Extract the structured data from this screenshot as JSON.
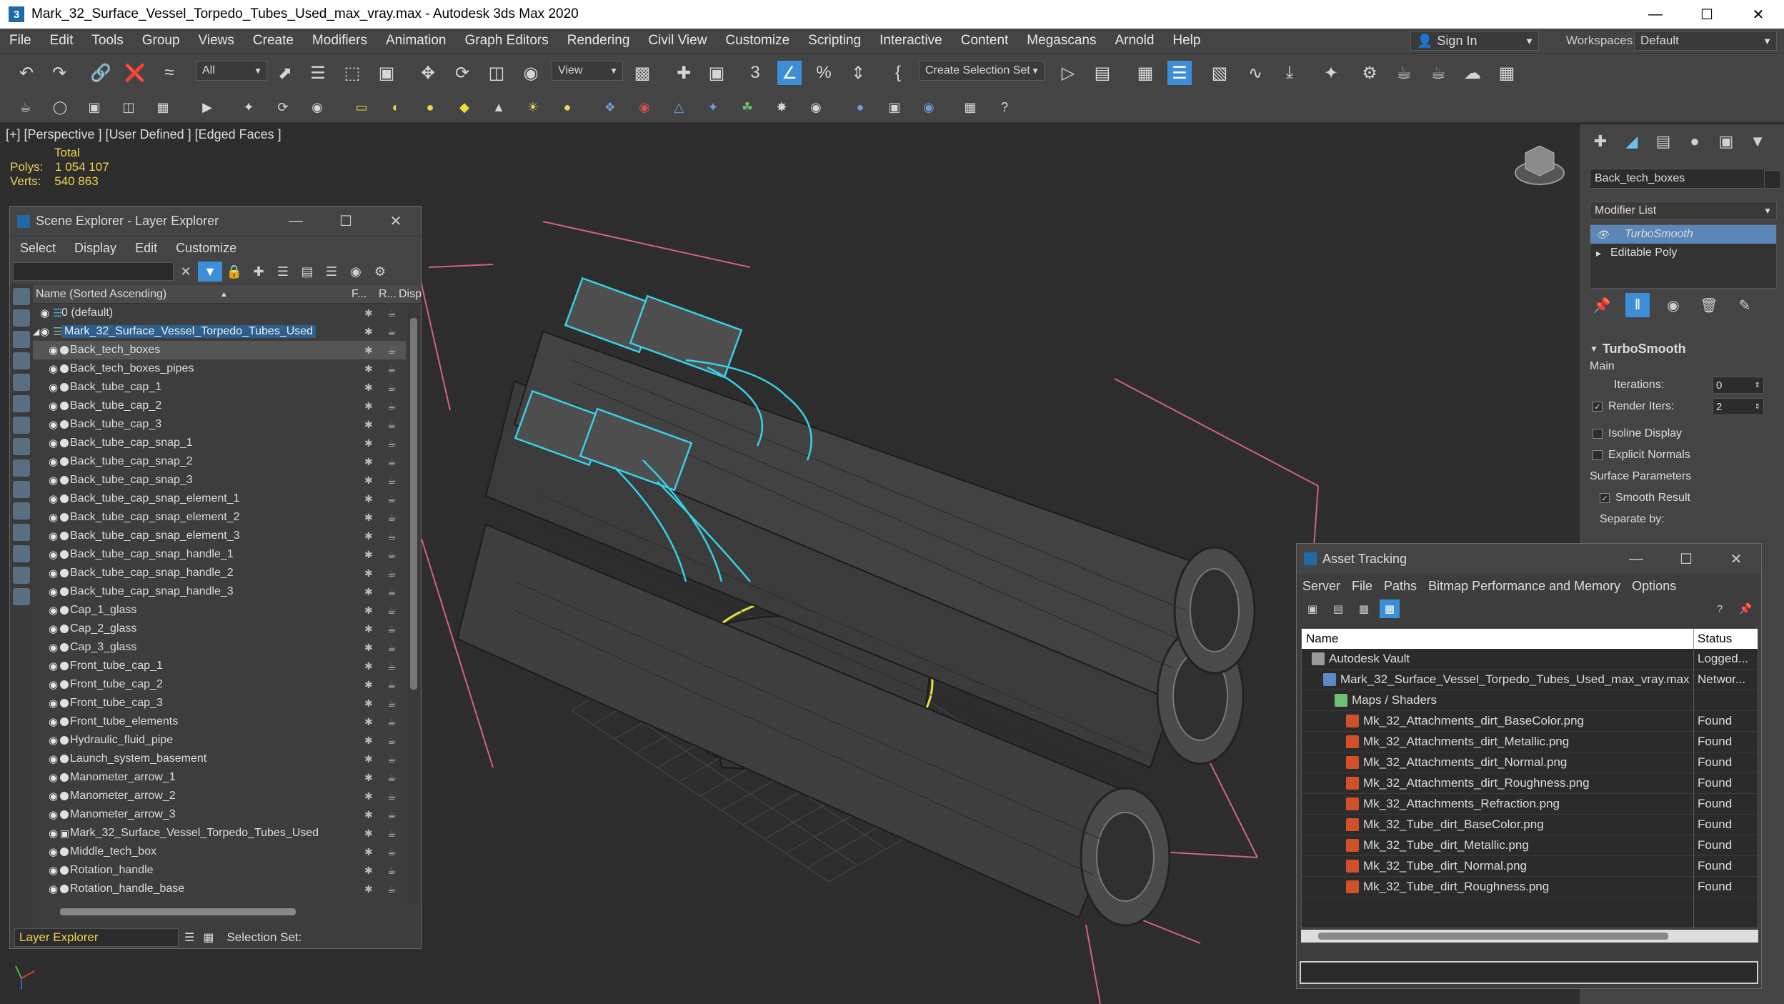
{
  "window": {
    "title": "Mark_32_Surface_Vessel_Torpedo_Tubes_Used_max_vray.max - Autodesk 3ds Max 2020",
    "app_icon": "3"
  },
  "menu": [
    "File",
    "Edit",
    "Tools",
    "Group",
    "Views",
    "Create",
    "Modifiers",
    "Animation",
    "Graph Editors",
    "Rendering",
    "Civil View",
    "Customize",
    "Scripting",
    "Interactive",
    "Content",
    "Megascans",
    "Arnold",
    "Help"
  ],
  "signin": {
    "label": "Sign In"
  },
  "workspaces": {
    "label": "Workspaces:",
    "value": "Default"
  },
  "toolbar": {
    "filter": "All",
    "view": "View",
    "selection_set": "Create Selection Set",
    "snap_label": "3"
  },
  "viewport": {
    "label": "[+] [Perspective ] [User Defined ] [Edged Faces ]",
    "stats": {
      "total_label": "Total",
      "polys_label": "Polys:",
      "polys": "1 054 107",
      "verts_label": "Verts:",
      "verts": "540 863"
    }
  },
  "scene_explorer": {
    "title": "Scene Explorer - Layer Explorer",
    "menu": [
      "Select",
      "Display",
      "Edit",
      "Customize"
    ],
    "columns": {
      "name": "Name (Sorted Ascending)",
      "freeze": "F...",
      "render": "R...",
      "display": "Disp"
    },
    "rows": [
      {
        "name": "0 (default)",
        "level": 0,
        "type": "layer"
      },
      {
        "name": "Mark_32_Surface_Vessel_Torpedo_Tubes_Used",
        "level": 0,
        "type": "layer-selected"
      },
      {
        "name": "Back_tech_boxes",
        "level": 1,
        "type": "object-highlight"
      },
      {
        "name": "Back_tech_boxes_pipes",
        "level": 1,
        "type": "object"
      },
      {
        "name": "Back_tube_cap_1",
        "level": 1,
        "type": "object"
      },
      {
        "name": "Back_tube_cap_2",
        "level": 1,
        "type": "object"
      },
      {
        "name": "Back_tube_cap_3",
        "level": 1,
        "type": "object"
      },
      {
        "name": "Back_tube_cap_snap_1",
        "level": 1,
        "type": "object"
      },
      {
        "name": "Back_tube_cap_snap_2",
        "level": 1,
        "type": "object"
      },
      {
        "name": "Back_tube_cap_snap_3",
        "level": 1,
        "type": "object"
      },
      {
        "name": "Back_tube_cap_snap_element_1",
        "level": 1,
        "type": "object"
      },
      {
        "name": "Back_tube_cap_snap_element_2",
        "level": 1,
        "type": "object"
      },
      {
        "name": "Back_tube_cap_snap_element_3",
        "level": 1,
        "type": "object"
      },
      {
        "name": "Back_tube_cap_snap_handle_1",
        "level": 1,
        "type": "object"
      },
      {
        "name": "Back_tube_cap_snap_handle_2",
        "level": 1,
        "type": "object"
      },
      {
        "name": "Back_tube_cap_snap_handle_3",
        "level": 1,
        "type": "object"
      },
      {
        "name": "Cap_1_glass",
        "level": 1,
        "type": "object"
      },
      {
        "name": "Cap_2_glass",
        "level": 1,
        "type": "object"
      },
      {
        "name": "Cap_3_glass",
        "level": 1,
        "type": "object"
      },
      {
        "name": "Front_tube_cap_1",
        "level": 1,
        "type": "object"
      },
      {
        "name": "Front_tube_cap_2",
        "level": 1,
        "type": "object"
      },
      {
        "name": "Front_tube_cap_3",
        "level": 1,
        "type": "object"
      },
      {
        "name": "Front_tube_elements",
        "level": 1,
        "type": "object"
      },
      {
        "name": "Hydraulic_fluid_pipe",
        "level": 1,
        "type": "object"
      },
      {
        "name": "Launch_system_basement",
        "level": 1,
        "type": "object"
      },
      {
        "name": "Manometer_arrow_1",
        "level": 1,
        "type": "object"
      },
      {
        "name": "Manometer_arrow_2",
        "level": 1,
        "type": "object"
      },
      {
        "name": "Manometer_arrow_3",
        "level": 1,
        "type": "object"
      },
      {
        "name": "Mark_32_Surface_Vessel_Torpedo_Tubes_Used",
        "level": 1,
        "type": "group"
      },
      {
        "name": "Middle_tech_box",
        "level": 1,
        "type": "object"
      },
      {
        "name": "Rotation_handle",
        "level": 1,
        "type": "object"
      },
      {
        "name": "Rotation_handle_base",
        "level": 1,
        "type": "object"
      }
    ],
    "bottom": {
      "layer_explorer": "Layer Explorer",
      "selection_set_label": "Selection Set:"
    }
  },
  "command_panel": {
    "object_name": "Back_tech_boxes",
    "modifier_list": "Modifier List",
    "stack": [
      {
        "name": "TurboSmooth",
        "active": true
      },
      {
        "name": "Editable Poly",
        "active": false
      }
    ],
    "turbosmooth": {
      "title": "TurboSmooth",
      "main_label": "Main",
      "iterations_label": "Iterations:",
      "iterations": "0",
      "render_iters_label": "Render Iters:",
      "render_iters": "2",
      "isoline": "Isoline Display",
      "explicit_normals": "Explicit Normals",
      "surface_params": "Surface Parameters",
      "smooth_result": "Smooth Result",
      "separate_by": "Separate by:"
    }
  },
  "asset_tracking": {
    "title": "Asset Tracking",
    "menu": [
      "Server",
      "File",
      "Paths",
      "Bitmap Performance and Memory",
      "Options"
    ],
    "columns": {
      "name": "Name",
      "status": "Status"
    },
    "rows": [
      {
        "name": "Autodesk Vault",
        "status": "Logged...",
        "level": 0,
        "icon": "vault"
      },
      {
        "name": "Mark_32_Surface_Vessel_Torpedo_Tubes_Used_max_vray.max",
        "status": "Networ...",
        "level": 1,
        "icon": "max"
      },
      {
        "name": "Maps / Shaders",
        "status": "",
        "level": 2,
        "icon": "folder"
      },
      {
        "name": "Mk_32_Attachments_dirt_BaseColor.png",
        "status": "Found",
        "level": 3,
        "icon": "image"
      },
      {
        "name": "Mk_32_Attachments_dirt_Metallic.png",
        "status": "Found",
        "level": 3,
        "icon": "image"
      },
      {
        "name": "Mk_32_Attachments_dirt_Normal.png",
        "status": "Found",
        "level": 3,
        "icon": "image"
      },
      {
        "name": "Mk_32_Attachments_dirt_Roughness.png",
        "status": "Found",
        "level": 3,
        "icon": "image"
      },
      {
        "name": "Mk_32_Attachments_Refraction.png",
        "status": "Found",
        "level": 3,
        "icon": "image"
      },
      {
        "name": "Mk_32_Tube_dirt_BaseColor.png",
        "status": "Found",
        "level": 3,
        "icon": "image"
      },
      {
        "name": "Mk_32_Tube_dirt_Metallic.png",
        "status": "Found",
        "level": 3,
        "icon": "image"
      },
      {
        "name": "Mk_32_Tube_dirt_Normal.png",
        "status": "Found",
        "level": 3,
        "icon": "image"
      },
      {
        "name": "Mk_32_Tube_dirt_Roughness.png",
        "status": "Found",
        "level": 3,
        "icon": "image"
      }
    ]
  },
  "colors": {
    "accent": "#3c8fd6",
    "selection_cyan": "#37d0e6",
    "selection_yellow": "#e8e03a",
    "stats_yellow": "#f0d350",
    "bbox_pink": "#d2637a"
  }
}
